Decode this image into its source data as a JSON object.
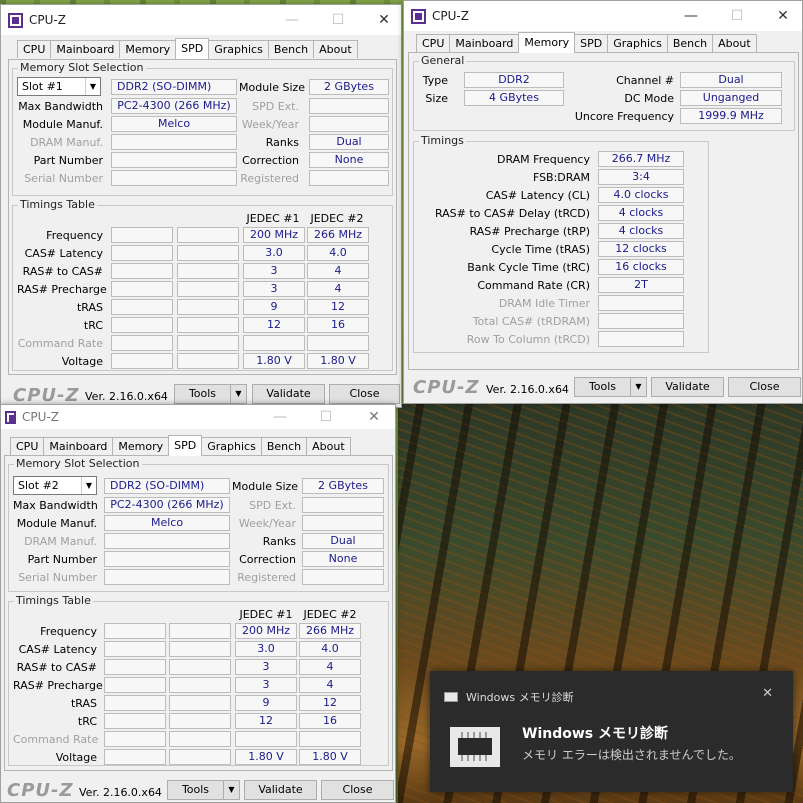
{
  "app_title": "CPU-Z",
  "win_ctl": {
    "minimize": "—",
    "maximize": "☐",
    "close": "✕"
  },
  "tabs": [
    "CPU",
    "Mainboard",
    "Memory",
    "SPD",
    "Graphics",
    "Bench",
    "About"
  ],
  "spd_labels": {
    "group_slot": "Memory Slot Selection",
    "module_size": "Module Size",
    "max_bandwidth": "Max Bandwidth",
    "spd_ext": "SPD Ext.",
    "module_manuf": "Module Manuf.",
    "week_year": "Week/Year",
    "dram_manuf": "DRAM Manuf.",
    "ranks": "Ranks",
    "part_number": "Part Number",
    "correction": "Correction",
    "serial_number": "Serial Number",
    "registered": "Registered",
    "group_timings": "Timings Table",
    "jedec1": "JEDEC #1",
    "jedec2": "JEDEC #2",
    "frequency": "Frequency",
    "cas": "CAS# Latency",
    "ras_cas": "RAS# to CAS#",
    "ras_pre": "RAS# Precharge",
    "tras": "tRAS",
    "trc": "tRC",
    "command_rate": "Command Rate",
    "voltage": "Voltage"
  },
  "spd_windows": [
    {
      "slot": "Slot #1",
      "type": "DDR2 (SO-DIMM)",
      "module_size": "2 GBytes",
      "max_bandwidth": "PC2-4300 (266 MHz)",
      "module_manuf": "Melco",
      "ranks": "Dual",
      "correction": "None",
      "jedec1": {
        "frequency": "200 MHz",
        "cas": "3.0",
        "ras_cas": "3",
        "ras_pre": "3",
        "tras": "9",
        "trc": "12",
        "voltage": "1.80 V"
      },
      "jedec2": {
        "frequency": "266 MHz",
        "cas": "4.0",
        "ras_cas": "4",
        "ras_pre": "4",
        "tras": "12",
        "trc": "16",
        "voltage": "1.80 V"
      }
    },
    {
      "slot": "Slot #2",
      "type": "DDR2 (SO-DIMM)",
      "module_size": "2 GBytes",
      "max_bandwidth": "PC2-4300 (266 MHz)",
      "module_manuf": "Melco",
      "ranks": "Dual",
      "correction": "None",
      "jedec1": {
        "frequency": "200 MHz",
        "cas": "3.0",
        "ras_cas": "3",
        "ras_pre": "3",
        "tras": "9",
        "trc": "12",
        "voltage": "1.80 V"
      },
      "jedec2": {
        "frequency": "266 MHz",
        "cas": "4.0",
        "ras_cas": "4",
        "ras_pre": "4",
        "tras": "12",
        "trc": "16",
        "voltage": "1.80 V"
      }
    }
  ],
  "memory_window": {
    "group_general": "General",
    "type_label": "Type",
    "type": "DDR2",
    "size_label": "Size",
    "size": "4 GBytes",
    "channel_label": "Channel #",
    "channel": "Dual",
    "dc_mode_label": "DC Mode",
    "dc_mode": "Unganged",
    "uncore_label": "Uncore Frequency",
    "uncore": "1999.9 MHz",
    "group_timings": "Timings",
    "dram_freq_label": "DRAM Frequency",
    "dram_freq": "266.7 MHz",
    "fsb_label": "FSB:DRAM",
    "fsb": "3:4",
    "cas_label": "CAS# Latency (CL)",
    "cas": "4.0 clocks",
    "trcd_label": "RAS# to CAS# Delay (tRCD)",
    "trcd": "4 clocks",
    "trp_label": "RAS# Precharge (tRP)",
    "trp": "4 clocks",
    "tras_label": "Cycle Time (tRAS)",
    "tras": "12 clocks",
    "trc_label": "Bank Cycle Time (tRC)",
    "trc": "16 clocks",
    "cr_label": "Command Rate (CR)",
    "cr": "2T",
    "idle_label": "DRAM Idle Timer",
    "trdram_label": "Total CAS# (tRDRAM)",
    "rtc_label": "Row To Column (tRCD)"
  },
  "footer": {
    "logo": "CPU-Z",
    "version": "Ver. 2.16.0.x64",
    "tools": "Tools",
    "validate": "Validate",
    "close": "Close"
  },
  "toast": {
    "app_name": "Windows メモリ診断",
    "title": "Windows メモリ診断",
    "body": "メモリ エラーは検出されませんでした。",
    "close": "✕"
  }
}
